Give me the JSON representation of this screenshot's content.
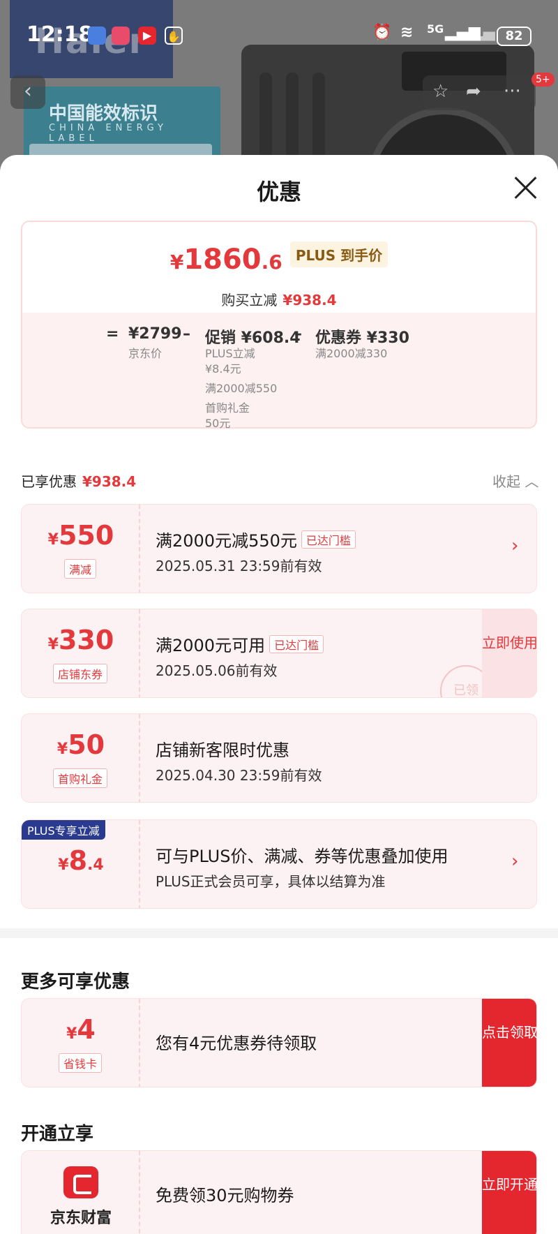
{
  "status_bar": {
    "time": "12:18",
    "network": "5G",
    "battery": "82"
  },
  "background": {
    "brand_text": "Haier",
    "energy_label_cn": "中国能效标识",
    "energy_label_en": "CHINA ENERGY LABEL",
    "badge": "5+"
  },
  "sheet": {
    "title": "优惠"
  },
  "summary": {
    "currency": "¥",
    "final_price_int": "1860",
    "final_price_dec": ".6",
    "final_tag": "PLUS 到手价",
    "reduce_label": "购买立减",
    "reduce_value": "¥938.4",
    "eq": "=",
    "minus": "–",
    "jd_price": "¥2799",
    "jd_price_label": "京东价",
    "promo": "促销 ¥608.4",
    "promo_items": [
      "PLUS立减",
      "¥8.4元",
      "满2000减550",
      "首购礼金",
      "50元"
    ],
    "coupon": "优惠券 ¥330",
    "coupon_items": [
      "满2000减330"
    ]
  },
  "enjoyed": {
    "label": "已享优惠",
    "value": "¥938.4",
    "collapse": "收起"
  },
  "cards": [
    {
      "currency": "¥",
      "amount": "550",
      "tag": "满减",
      "title": "满2000元减550元",
      "reached": "已达门槛",
      "validity": "2025.05.31 23:59前有效"
    },
    {
      "currency": "¥",
      "amount": "330",
      "tag": "店铺东券",
      "title": "满2000元可用",
      "reached": "已达门槛",
      "validity": "2025.05.06前有效",
      "action": "立即使用",
      "stamp": "已领"
    },
    {
      "currency": "¥",
      "amount": "50",
      "tag": "首购礼金",
      "title": "店铺新客限时优惠",
      "validity": "2025.04.30 23:59前有效"
    },
    {
      "flag": "PLUS专享立减",
      "currency": "¥",
      "amount": "8",
      "amount_dec": ".4",
      "title": "可与PLUS价、满减、券等优惠叠加使用",
      "validity": "PLUS正式会员可享，具体以结算为准"
    }
  ],
  "more": {
    "title": "更多可享优惠",
    "card": {
      "currency": "¥",
      "amount": "4",
      "tag": "省钱卡",
      "title": "您有4元优惠券待领取",
      "action": "点击领取"
    }
  },
  "open": {
    "title": "开通立享",
    "card": {
      "name": "京东财富",
      "title": "免费领30元购物券",
      "action": "立即开通"
    }
  },
  "colors": {
    "accent_red": "#e4393c",
    "button_red": "#e4262e",
    "plus_navy": "#2a3a8f"
  }
}
